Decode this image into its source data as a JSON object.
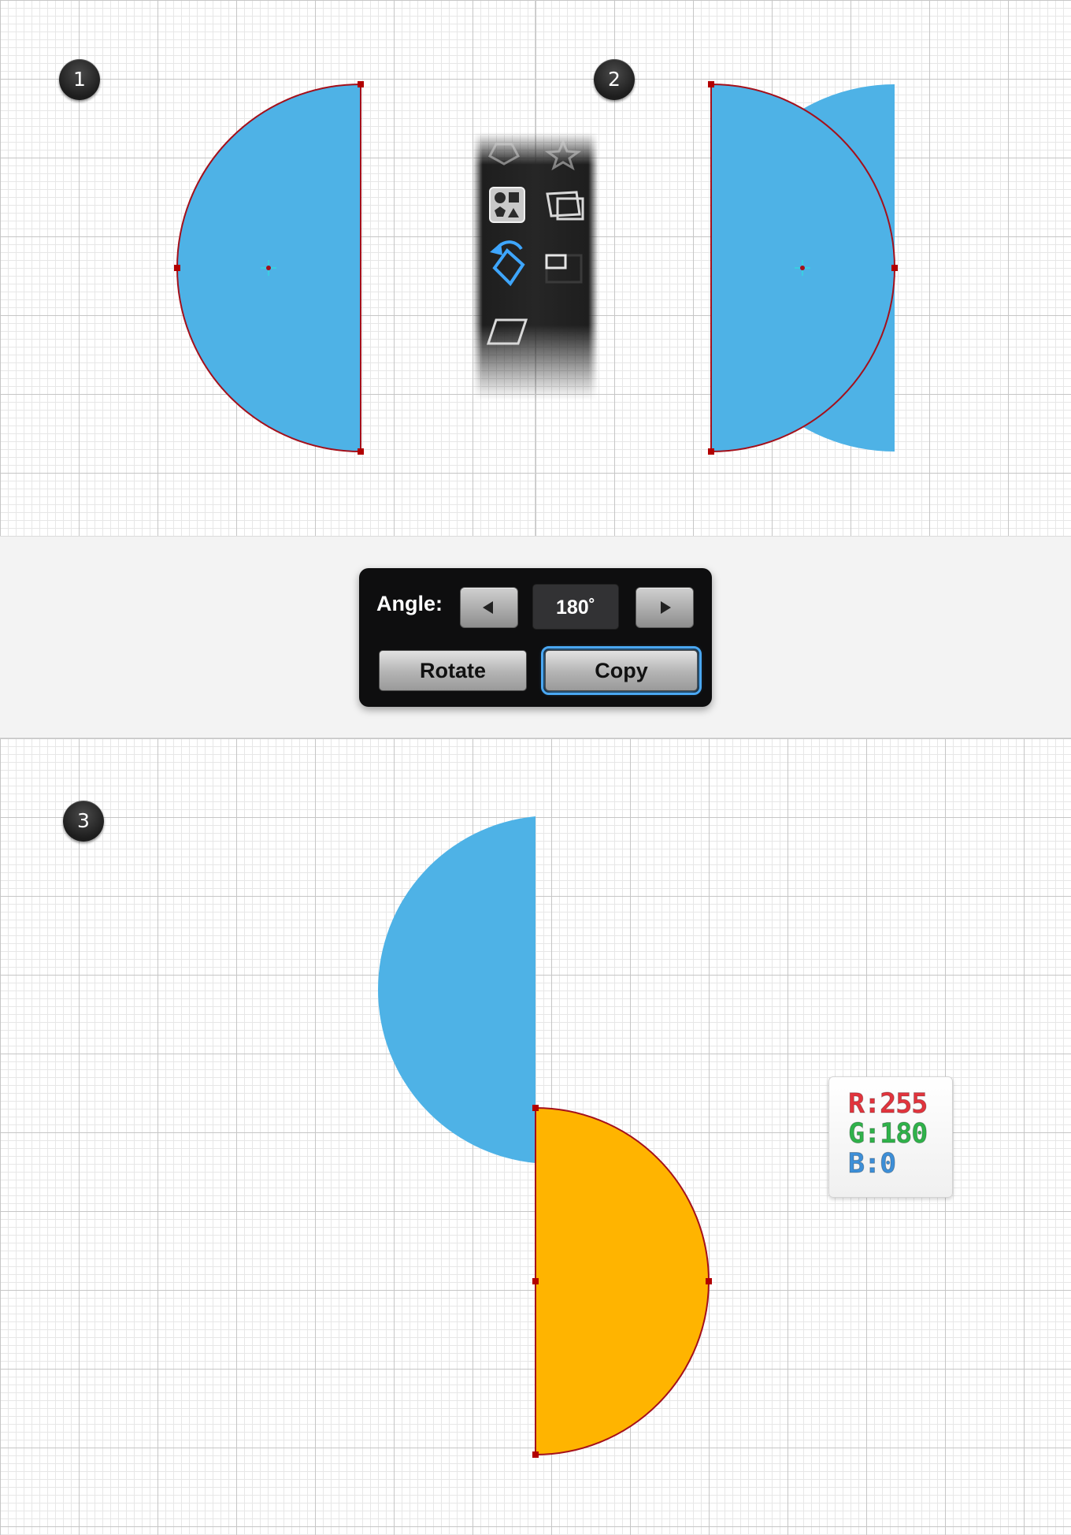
{
  "steps": {
    "one": "1",
    "two": "2",
    "three": "3"
  },
  "rotate_dialog": {
    "angle_label": "Angle:",
    "angle_value": "180˚",
    "rotate_label": "Rotate",
    "copy_label": "Copy"
  },
  "color": {
    "r_line": "R:255",
    "g_line": "G:180",
    "b_line": "B:0",
    "r_color": "#e2343d",
    "g_color": "#2fb24a",
    "b_color": "#3d8fd8"
  },
  "shapes": {
    "blue_fill": "#4eb2e6",
    "orange_fill": "#ffb400",
    "path_stroke": "#a4101b"
  },
  "toolbar": {
    "icons": [
      "polygon-tool-icon",
      "star-tool-icon",
      "shape-builder-icon",
      "perspective-tool-icon",
      "rotate-tool-icon",
      "scale-tool-icon",
      "shear-tool-icon"
    ],
    "active": "rotate-tool-icon"
  }
}
